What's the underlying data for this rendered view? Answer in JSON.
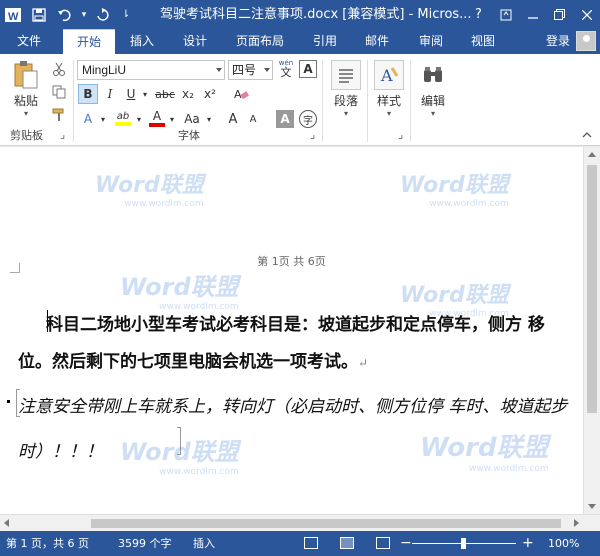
{
  "titlebar": {
    "title": "驾驶考试科目二注意事项.docx [兼容模式] - Micros...",
    "help": "?"
  },
  "tabs": {
    "file": "文件",
    "items": [
      {
        "label": "开始",
        "active": true
      },
      {
        "label": "插入"
      },
      {
        "label": "设计"
      },
      {
        "label": "页面布局"
      },
      {
        "label": "引用"
      },
      {
        "label": "邮件"
      },
      {
        "label": "审阅"
      },
      {
        "label": "视图"
      }
    ],
    "login": "登录"
  },
  "ribbon": {
    "clipboard": {
      "paste_label": "粘贴",
      "group_label": "剪贴板"
    },
    "font": {
      "font_name": "MingLiU",
      "font_size": "四号",
      "wen_label": "wén",
      "wen_char": "文",
      "bold": "B",
      "italic": "I",
      "underline": "U",
      "strike": "abc",
      "subscript": "x₂",
      "superscript": "x²",
      "text_effect": "A",
      "highlight": "ab",
      "font_color": "A",
      "change_case": "Aa",
      "grow": "A",
      "shrink": "A",
      "shading": "A",
      "enclose": "字",
      "group_label": "字体"
    },
    "paragraph": {
      "label": "段落"
    },
    "styles": {
      "label": "样式"
    },
    "editing": {
      "label": "编辑"
    }
  },
  "document": {
    "header": "第 1页 共 6页",
    "para1": "科目二场地小型车考试必考科目是：坡道起步和定点停车，侧方 移位。然后剩下的七项里电脑会机选一项考试。",
    "para_mark": "↵",
    "para2": "注意安全带刚上车就系上，转向灯（必启动时、侧方位停 车时、坡道起步时）！！！"
  },
  "watermark": {
    "text": "Word联盟",
    "sub": "www.wordlm.com"
  },
  "status": {
    "page": "第 1 页，共 6 页",
    "words": "3599 个字",
    "mode": "插入",
    "zoom_minus": "−",
    "zoom_plus": "+",
    "zoom": "100%"
  },
  "colors": {
    "accent": "#2b579a",
    "highlight": "#ffff00",
    "font_color": "#e00000"
  }
}
